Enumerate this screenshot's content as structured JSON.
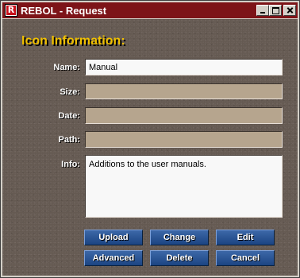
{
  "window": {
    "title": "REBOL - Request",
    "app_icon_letter": "R"
  },
  "form": {
    "heading": "Icon Information:",
    "fields": {
      "name": {
        "label": "Name:",
        "value": "Manual"
      },
      "size": {
        "label": "Size:",
        "value": ""
      },
      "date": {
        "label": "Date:",
        "value": ""
      },
      "path": {
        "label": "Path:",
        "value": ""
      },
      "info": {
        "label": "Info:",
        "value": "Additions to the user manuals."
      }
    }
  },
  "buttons": {
    "upload": "Upload",
    "change": "Change",
    "edit": "Edit",
    "advanced": "Advanced",
    "delete": "Delete",
    "cancel": "Cancel"
  },
  "colors": {
    "titlebar": "#7d1418",
    "panel_background": "#655a52",
    "heading": "#f0c000",
    "button": "#2a5596",
    "readonly_field": "#b6a58e"
  },
  "icons": {
    "app": "rebol-logo-icon",
    "minimize": "minimize-icon",
    "maximize": "maximize-icon",
    "close": "close-icon"
  }
}
